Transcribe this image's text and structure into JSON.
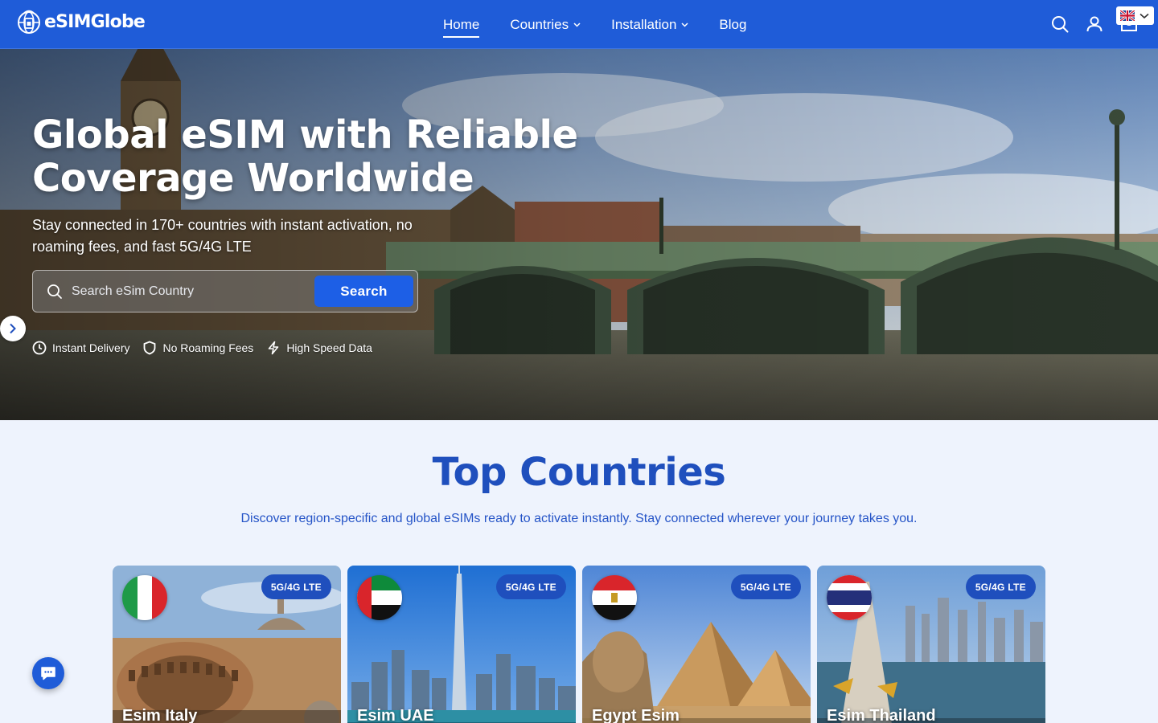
{
  "brand": {
    "name": "eSIMGlobe",
    "logo_icon": "globe-sim-icon"
  },
  "nav": {
    "items": [
      {
        "label": "Home",
        "active": true,
        "dropdown": false
      },
      {
        "label": "Countries",
        "active": false,
        "dropdown": true
      },
      {
        "label": "Installation",
        "active": false,
        "dropdown": true
      },
      {
        "label": "Blog",
        "active": false,
        "dropdown": false
      }
    ]
  },
  "header_icons": [
    "search-icon",
    "user-icon",
    "cart-icon"
  ],
  "language": {
    "flag": "uk-flag-icon"
  },
  "hero": {
    "title": "Global eSIM with Reliable Coverage Worldwide",
    "subtitle": "Stay connected in 170+ countries with instant activation, no roaming fees, and fast 5G/4G LTE",
    "search": {
      "placeholder": "Search eSim Country",
      "button_label": "Search"
    },
    "features": [
      {
        "icon": "clock-icon",
        "label": "Instant Delivery"
      },
      {
        "icon": "shield-icon",
        "label": "No Roaming Fees"
      },
      {
        "icon": "lightning-icon",
        "label": "High Speed Data"
      }
    ]
  },
  "top_countries": {
    "title": "Top Countries",
    "description": "Discover region-specific and global eSIMs ready to activate instantly. Stay connected wherever your journey takes you.",
    "cards": [
      {
        "name": "Esim Italy",
        "badge": "5G/4G LTE",
        "flag": "italy-flag-icon"
      },
      {
        "name": "Esim UAE",
        "badge": "5G/4G LTE",
        "flag": "uae-flag-icon"
      },
      {
        "name": "Egypt Esim",
        "badge": "5G/4G LTE",
        "flag": "egypt-flag-icon"
      },
      {
        "name": "Esim Thailand",
        "badge": "5G/4G LTE",
        "flag": "thailand-flag-icon"
      }
    ]
  },
  "colors": {
    "primary": "#1f5cd8",
    "heading": "#1f4fbd",
    "page_bg": "#eef3fd",
    "button": "#1d5fe6"
  }
}
